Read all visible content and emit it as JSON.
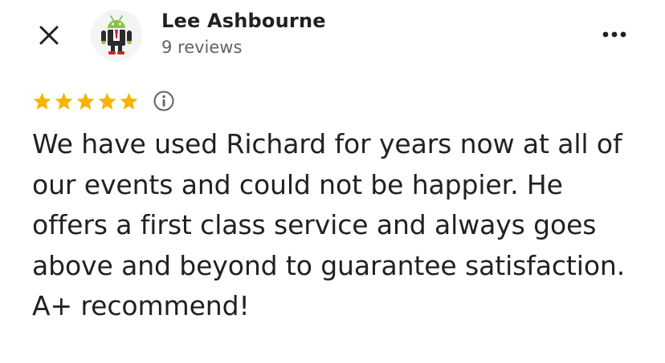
{
  "header": {
    "close_icon": "close-icon",
    "avatar_icon": "android-robot-avatar",
    "reviewer_name": "Lee Ashbourne",
    "review_count": "9 reviews",
    "more_icon": "more-horizontal-icon"
  },
  "rating": {
    "stars": 5,
    "max_stars": 5,
    "star_color": "#F4B400",
    "info_icon": "info-icon"
  },
  "review": {
    "text": "We have used Richard for years now at all of our events and could not be happier. He offers a first class service and always goes above and beyond to guarantee satisfaction. A+ recommend!"
  }
}
